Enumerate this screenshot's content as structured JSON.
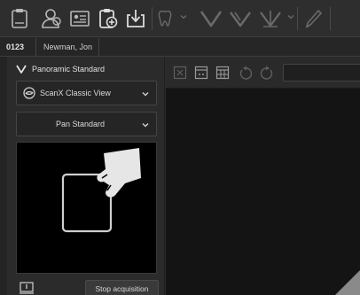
{
  "patient": {
    "id": "0123",
    "name": "Newman, Jon"
  },
  "acquisition": {
    "mode_title": "Panoramic Standard",
    "view_select": "ScanX Classic View",
    "program_select": "Pan Standard",
    "stop_label": "Stop acquisition"
  },
  "colors": {
    "accent": "#cfcfcf",
    "disabled": "#6a6a6a",
    "background": "#2c2c2c",
    "viewer": "#141414"
  }
}
